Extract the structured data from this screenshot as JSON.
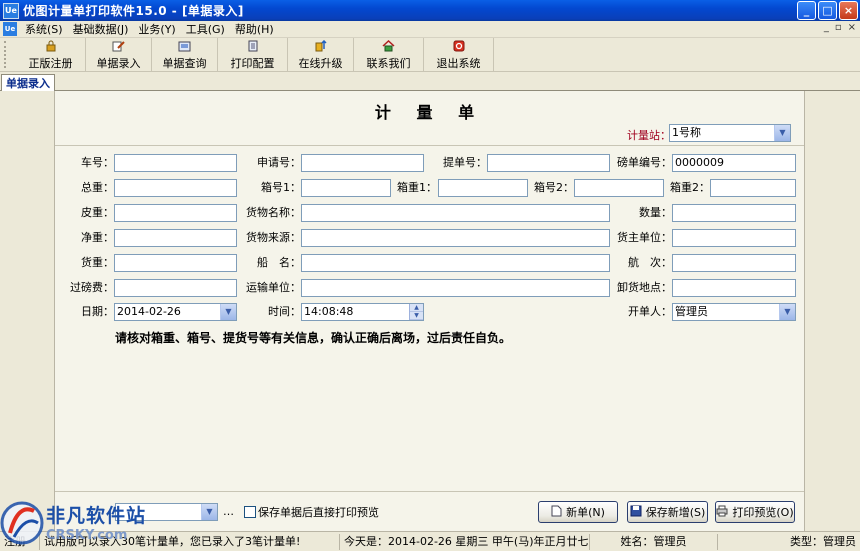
{
  "window": {
    "title": "优图计量单打印软件15.0 - [单据录入]",
    "app_icon": "Ue",
    "buttons": [
      "_",
      "□",
      "×"
    ]
  },
  "menu": {
    "items": [
      "系统(S)",
      "基础数据(J)",
      "业务(Y)",
      "工具(G)",
      "帮助(H)"
    ],
    "mdi_buttons": [
      "_",
      "▫",
      "×"
    ]
  },
  "toolbar": {
    "items": [
      {
        "label": "正版注册",
        "icon": "lock-icon"
      },
      {
        "label": "单据录入",
        "icon": "edit-icon"
      },
      {
        "label": "单据查询",
        "icon": "query-icon"
      },
      {
        "label": "打印配置",
        "icon": "print-config-icon"
      },
      {
        "label": "在线升级",
        "icon": "upgrade-icon"
      },
      {
        "label": "联系我们",
        "icon": "home-icon"
      },
      {
        "label": "退出系统",
        "icon": "exit-icon"
      }
    ]
  },
  "tab": {
    "label": "单据录入"
  },
  "form": {
    "title": "计 量 单",
    "station_label": "计量站：",
    "station_value": "1号称",
    "fields": {
      "car_no": {
        "label": "车号：",
        "value": ""
      },
      "apply_no": {
        "label": "申请号：",
        "value": ""
      },
      "bill_no": {
        "label": "提单号：",
        "value": ""
      },
      "weigh_no": {
        "label": "磅单编号：",
        "value": "0000009"
      },
      "gross": {
        "label": "总重：",
        "value": ""
      },
      "box1": {
        "label": "箱号1：",
        "value": ""
      },
      "boxw1": {
        "label": "箱重1：",
        "value": ""
      },
      "box2": {
        "label": "箱号2：",
        "value": ""
      },
      "boxw2": {
        "label": "箱重2：",
        "value": ""
      },
      "tare": {
        "label": "皮重：",
        "value": ""
      },
      "goods_name": {
        "label": "货物名称：",
        "value": ""
      },
      "quantity": {
        "label": "数量：",
        "value": ""
      },
      "net": {
        "label": "净重：",
        "value": ""
      },
      "goods_source": {
        "label": "货物来源：",
        "value": ""
      },
      "owner": {
        "label": "货主单位：",
        "value": ""
      },
      "cargo": {
        "label": "货重：",
        "value": ""
      },
      "ship": {
        "label": "船　名：",
        "value": ""
      },
      "voyage": {
        "label": "航　次：",
        "value": ""
      },
      "fee": {
        "label": "过磅费：",
        "value": ""
      },
      "transport": {
        "label": "运输单位：",
        "value": ""
      },
      "unload": {
        "label": "卸货地点：",
        "value": ""
      },
      "date": {
        "label": "日期：",
        "value": "2014-02-26"
      },
      "time": {
        "label": "时间：",
        "value": "14:08:48"
      },
      "issuer": {
        "label": "开单人：",
        "value": "管理员"
      }
    },
    "notice": "请核对箱重、箱号、提货号等有关信息，确认正确后离场，过后责任自负。"
  },
  "bottom": {
    "ellipsis": "…",
    "checkbox_label": "保存单据后直接打印预览",
    "buttons": {
      "new": "新单(N)",
      "save_new": "保存新增(S)",
      "print_preview": "打印预览(O)"
    }
  },
  "status": {
    "mode": "注册",
    "info": "试用版可以录入30笔计量单，您已录入了3笔计量单!",
    "today": "今天是：2014-02-26  星期三  甲午(马)年正月廿七",
    "name": "姓名：管理员",
    "type": "类型：管理员"
  },
  "watermark": {
    "brand": "非凡软件站",
    "site": "CRSKY.com"
  },
  "colors": {
    "titlebar": "#0348d0",
    "station_label": "#a0001e",
    "tab_text": "#0b2d8c"
  }
}
